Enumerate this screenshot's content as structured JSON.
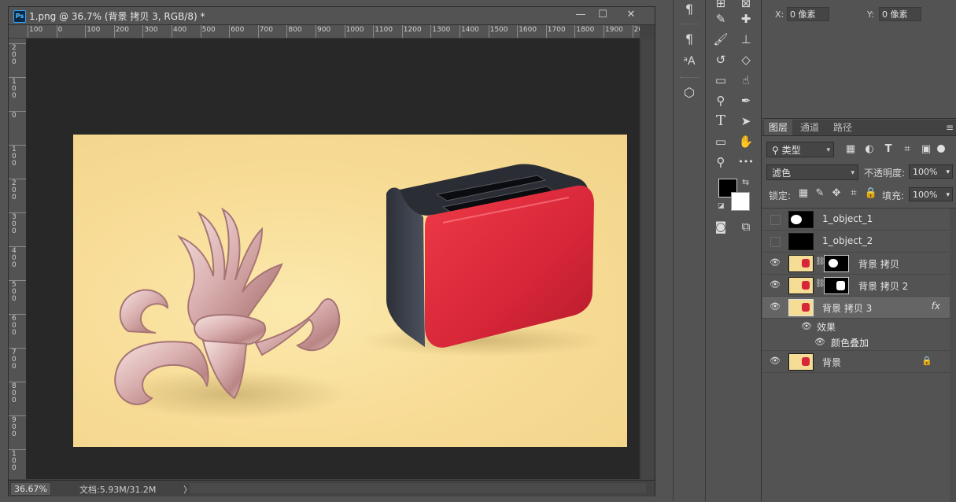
{
  "document": {
    "title": "1.png @ 36.7% (背景 拷贝 3, RGB/8) *",
    "app_icon": "Ps",
    "window_buttons": {
      "minimize": "—",
      "maximize": "☐",
      "close": "✕"
    },
    "ruler_h": [
      "100",
      "0",
      "100",
      "200",
      "300",
      "400",
      "500",
      "600",
      "700",
      "800",
      "900",
      "1000",
      "1100",
      "1200",
      "1300",
      "1400",
      "1500",
      "1600",
      "1700",
      "1800",
      "1900",
      "20"
    ],
    "ruler_v": [
      "2\n0\n0",
      "1\n0\n0",
      "0",
      "1\n0\n0",
      "2\n0\n0",
      "3\n0\n0",
      "4\n0\n0",
      "5\n0\n0",
      "6\n0\n0",
      "7\n0\n0",
      "8\n0\n0",
      "9\n0\n0",
      "1\n0\n0"
    ],
    "status": {
      "zoom": "36.67%",
      "doc_size": "文档:5.93M/31.2M",
      "arrow": "〉"
    }
  },
  "dock": {
    "icons": [
      "paragraph-icon",
      "paragraph-style-icon",
      "character-style-icon",
      "3d-icon"
    ]
  },
  "tools": {
    "items": [
      "eyedropper-icon",
      "healing-brush-icon",
      "brush-icon",
      "clone-stamp-icon",
      "history-brush-icon",
      "eraser-icon",
      "gradient-icon",
      "blur-icon",
      "dodge-icon",
      "pen-icon",
      "type-icon",
      "path-select-icon",
      "shape-icon",
      "hand-icon",
      "zoom-icon",
      "more-icon"
    ],
    "type_label": "T",
    "more_label": "•••"
  },
  "properties": {
    "x_label": "X:",
    "x_value": "0 像素",
    "y_label": "Y:",
    "y_value": "0 像素"
  },
  "layers_panel": {
    "tabs": [
      "图层",
      "通道",
      "路径"
    ],
    "filter_kind": "类型",
    "blend_mode": "滤色",
    "opacity_label": "不透明度:",
    "opacity_value": "100%",
    "lock_label": "锁定:",
    "fill_label": "填充:",
    "fill_value": "100%",
    "layers": [
      {
        "name": "1_object_1",
        "visible": false
      },
      {
        "name": "1_object_2",
        "visible": false
      },
      {
        "name": "背景 拷贝",
        "visible": true
      },
      {
        "name": "背景 拷贝 2",
        "visible": true
      },
      {
        "name": "背景 拷贝 3",
        "visible": true,
        "fx": "fx"
      },
      {
        "name": "效果",
        "visible": true
      },
      {
        "name": "颜色叠加",
        "visible": true
      },
      {
        "name": "背景",
        "visible": true
      }
    ]
  },
  "colors": {
    "accent": "#2fa3f7",
    "toaster_red": "#d62638",
    "toaster_body": "#3e4450",
    "background_yellow": "#f8dd98"
  }
}
